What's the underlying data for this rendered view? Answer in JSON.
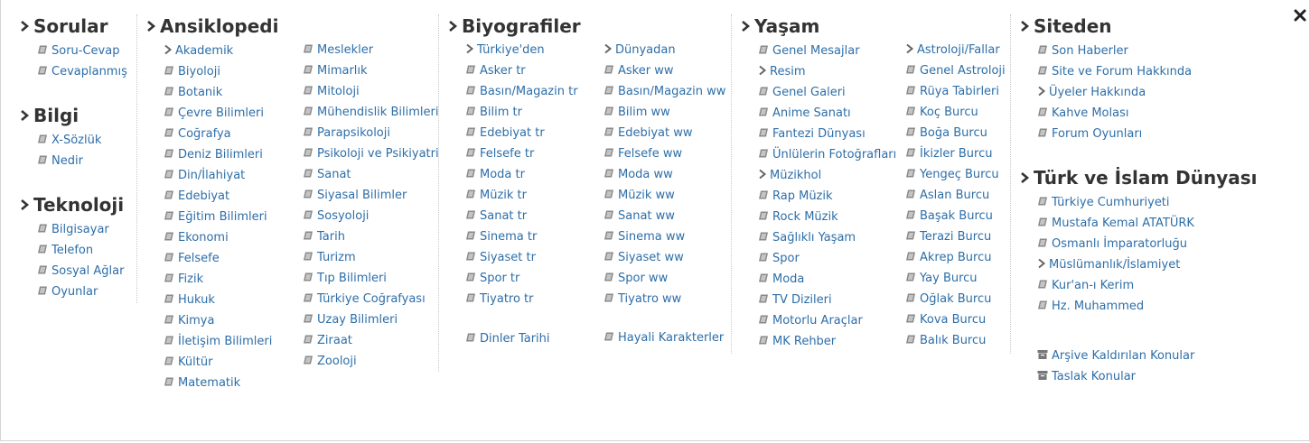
{
  "close_icon": "close-icon",
  "columns": {
    "sorular": {
      "title": "Sorular",
      "items": [
        {
          "label": "Soru-Cevap",
          "icon": "document-icon"
        },
        {
          "label": "Cevaplanmış",
          "icon": "document-icon"
        }
      ]
    },
    "bilgi": {
      "title": "Bilgi",
      "items": [
        {
          "label": "X-Sözlük",
          "icon": "document-icon"
        },
        {
          "label": "Nedir",
          "icon": "document-icon"
        }
      ]
    },
    "teknoloji": {
      "title": "Teknoloji",
      "items": [
        {
          "label": "Bilgisayar",
          "icon": "document-icon"
        },
        {
          "label": "Telefon",
          "icon": "document-icon"
        },
        {
          "label": "Sosyal Ağlar",
          "icon": "document-icon"
        },
        {
          "label": "Oyunlar",
          "icon": "document-icon"
        }
      ]
    },
    "ansiklopedi": {
      "title": "Ansiklopedi",
      "left": [
        {
          "label": "Akademik",
          "icon": "chevron-right-icon"
        },
        {
          "label": "Biyoloji",
          "icon": "document-icon"
        },
        {
          "label": "Botanik",
          "icon": "document-icon"
        },
        {
          "label": "Çevre Bilimleri",
          "icon": "document-icon"
        },
        {
          "label": "Coğrafya",
          "icon": "document-icon"
        },
        {
          "label": "Deniz Bilimleri",
          "icon": "document-icon"
        },
        {
          "label": "Din/İlahiyat",
          "icon": "document-icon"
        },
        {
          "label": "Edebiyat",
          "icon": "document-icon"
        },
        {
          "label": "Eğitim Bilimleri",
          "icon": "document-icon"
        },
        {
          "label": "Ekonomi",
          "icon": "document-icon"
        },
        {
          "label": "Felsefe",
          "icon": "document-icon"
        },
        {
          "label": "Fizik",
          "icon": "document-icon"
        },
        {
          "label": "Hukuk",
          "icon": "document-icon"
        },
        {
          "label": "Kimya",
          "icon": "document-icon"
        },
        {
          "label": "İletişim Bilimleri",
          "icon": "document-icon"
        },
        {
          "label": "Kültür",
          "icon": "document-icon"
        },
        {
          "label": "Matematik",
          "icon": "document-icon"
        }
      ],
      "right": [
        {
          "label": "Meslekler",
          "icon": "document-icon"
        },
        {
          "label": "Mimarlık",
          "icon": "document-icon"
        },
        {
          "label": "Mitoloji",
          "icon": "document-icon"
        },
        {
          "label": "Mühendislik Bilimleri",
          "icon": "document-icon"
        },
        {
          "label": "Parapsikoloji",
          "icon": "document-icon"
        },
        {
          "label": "Psikoloji ve Psikiyatri",
          "icon": "document-icon"
        },
        {
          "label": "Sanat",
          "icon": "document-icon"
        },
        {
          "label": "Siyasal Bilimler",
          "icon": "document-icon"
        },
        {
          "label": "Sosyoloji",
          "icon": "document-icon"
        },
        {
          "label": "Tarih",
          "icon": "document-icon"
        },
        {
          "label": "Turizm",
          "icon": "document-icon"
        },
        {
          "label": "Tıp Bilimleri",
          "icon": "document-icon"
        },
        {
          "label": "Türkiye Coğrafyası",
          "icon": "document-icon"
        },
        {
          "label": "Uzay Bilimleri",
          "icon": "document-icon"
        },
        {
          "label": "Ziraat",
          "icon": "document-icon"
        },
        {
          "label": "Zooloji",
          "icon": "document-icon"
        }
      ]
    },
    "biyografiler": {
      "title": "Biyografiler",
      "left": [
        {
          "label": "Türkiye'den",
          "icon": "chevron-right-icon"
        },
        {
          "label": "Asker tr",
          "icon": "document-icon"
        },
        {
          "label": "Basın/Magazin tr",
          "icon": "document-icon"
        },
        {
          "label": "Bilim tr",
          "icon": "document-icon"
        },
        {
          "label": "Edebiyat tr",
          "icon": "document-icon"
        },
        {
          "label": "Felsefe tr",
          "icon": "document-icon"
        },
        {
          "label": "Moda tr",
          "icon": "document-icon"
        },
        {
          "label": "Müzik tr",
          "icon": "document-icon"
        },
        {
          "label": "Sanat tr",
          "icon": "document-icon"
        },
        {
          "label": "Sinema tr",
          "icon": "document-icon"
        },
        {
          "label": "Siyaset tr",
          "icon": "document-icon"
        },
        {
          "label": "Spor tr",
          "icon": "document-icon"
        },
        {
          "label": "Tiyatro tr",
          "icon": "document-icon"
        }
      ],
      "right": [
        {
          "label": "Dünyadan",
          "icon": "chevron-right-icon"
        },
        {
          "label": "Asker ww",
          "icon": "document-icon"
        },
        {
          "label": "Basın/Magazin ww",
          "icon": "document-icon"
        },
        {
          "label": "Bilim ww",
          "icon": "document-icon"
        },
        {
          "label": "Edebiyat ww",
          "icon": "document-icon"
        },
        {
          "label": "Felsefe ww",
          "icon": "document-icon"
        },
        {
          "label": "Moda ww",
          "icon": "document-icon"
        },
        {
          "label": "Müzik ww",
          "icon": "document-icon"
        },
        {
          "label": "Sanat ww",
          "icon": "document-icon"
        },
        {
          "label": "Sinema ww",
          "icon": "document-icon"
        },
        {
          "label": "Siyaset ww",
          "icon": "document-icon"
        },
        {
          "label": "Spor ww",
          "icon": "document-icon"
        },
        {
          "label": "Tiyatro ww",
          "icon": "document-icon"
        }
      ],
      "extra_left": {
        "label": "Dinler Tarihi",
        "icon": "document-icon"
      },
      "extra_right": {
        "label": "Hayali Karakterler",
        "icon": "document-icon"
      }
    },
    "yasam": {
      "title": "Yaşam",
      "left": [
        {
          "label": "Genel Mesajlar",
          "icon": "document-icon"
        },
        {
          "label": "Resim",
          "icon": "chevron-right-icon"
        },
        {
          "label": "Genel Galeri",
          "icon": "document-icon"
        },
        {
          "label": "Anime Sanatı",
          "icon": "document-icon"
        },
        {
          "label": "Fantezi Dünyası",
          "icon": "document-icon"
        },
        {
          "label": "Ünlülerin Fotoğrafları",
          "icon": "document-icon"
        },
        {
          "label": "Müzikhol",
          "icon": "chevron-right-icon"
        },
        {
          "label": "Rap Müzik",
          "icon": "document-icon"
        },
        {
          "label": "Rock Müzik",
          "icon": "document-icon"
        },
        {
          "label": "Sağlıklı Yaşam",
          "icon": "document-icon"
        },
        {
          "label": "Spor",
          "icon": "document-icon"
        },
        {
          "label": "Moda",
          "icon": "document-icon"
        },
        {
          "label": "TV Dizileri",
          "icon": "document-icon"
        },
        {
          "label": "Motorlu Araçlar",
          "icon": "document-icon"
        },
        {
          "label": "MK Rehber",
          "icon": "document-icon"
        }
      ],
      "right": [
        {
          "label": "Astroloji/Fallar",
          "icon": "chevron-right-icon"
        },
        {
          "label": "Genel Astroloji",
          "icon": "document-icon"
        },
        {
          "label": "Rüya Tabirleri",
          "icon": "document-icon"
        },
        {
          "label": "Koç Burcu",
          "icon": "document-icon"
        },
        {
          "label": "Boğa Burcu",
          "icon": "document-icon"
        },
        {
          "label": "İkizler Burcu",
          "icon": "document-icon"
        },
        {
          "label": "Yengeç Burcu",
          "icon": "document-icon"
        },
        {
          "label": "Aslan Burcu",
          "icon": "document-icon"
        },
        {
          "label": "Başak Burcu",
          "icon": "document-icon"
        },
        {
          "label": "Terazi Burcu",
          "icon": "document-icon"
        },
        {
          "label": "Akrep Burcu",
          "icon": "document-icon"
        },
        {
          "label": "Yay Burcu",
          "icon": "document-icon"
        },
        {
          "label": "Oğlak Burcu",
          "icon": "document-icon"
        },
        {
          "label": "Kova Burcu",
          "icon": "document-icon"
        },
        {
          "label": "Balık Burcu",
          "icon": "document-icon"
        }
      ]
    },
    "siteden": {
      "title": "Siteden",
      "items": [
        {
          "label": "Son Haberler",
          "icon": "document-icon"
        },
        {
          "label": "Site ve Forum Hakkında",
          "icon": "document-icon"
        },
        {
          "label": "Üyeler Hakkında",
          "icon": "chevron-right-icon"
        },
        {
          "label": "Kahve Molası",
          "icon": "document-icon"
        },
        {
          "label": "Forum Oyunları",
          "icon": "document-icon"
        }
      ]
    },
    "turk_islam": {
      "title": "Türk ve İslam Dünyası",
      "items": [
        {
          "label": "Türkiye Cumhuriyeti",
          "icon": "document-icon"
        },
        {
          "label": "Mustafa Kemal ATATÜRK",
          "icon": "document-icon"
        },
        {
          "label": "Osmanlı İmparatorluğu",
          "icon": "document-icon"
        },
        {
          "label": "Müslümanlık/İslamiyet",
          "icon": "chevron-right-icon"
        },
        {
          "label": "Kur'an-ı Kerim",
          "icon": "document-icon"
        },
        {
          "label": "Hz. Muhammed",
          "icon": "document-icon"
        }
      ],
      "extra": [
        {
          "label": "Arşive Kaldırılan Konular",
          "icon": "archive-icon"
        },
        {
          "label": "Taslak Konular",
          "icon": "archive-icon"
        }
      ]
    }
  }
}
